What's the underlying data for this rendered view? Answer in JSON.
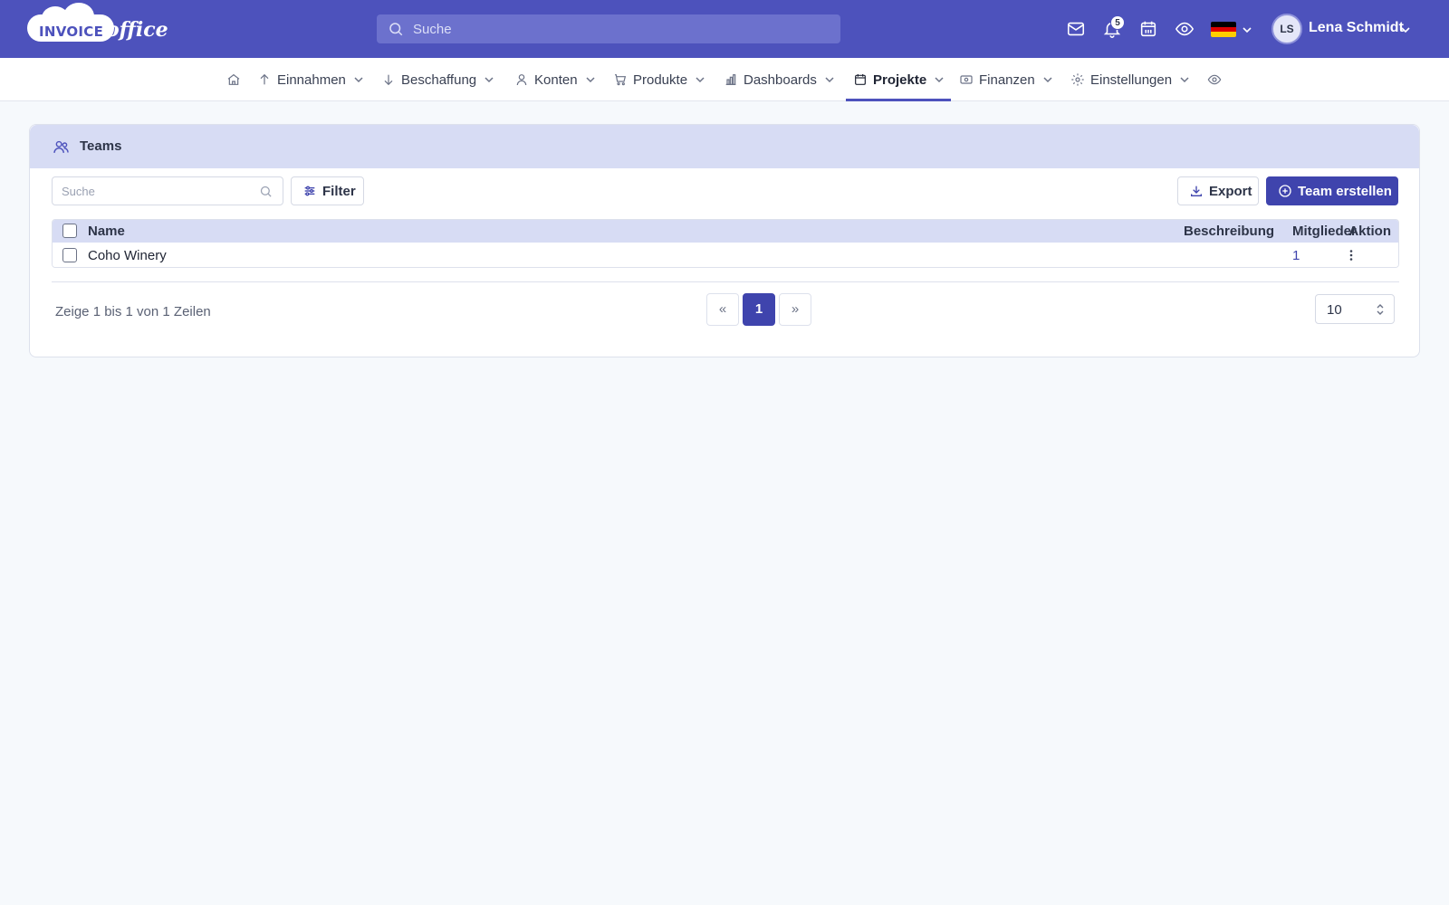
{
  "header": {
    "logo_word1": "INVOICE",
    "logo_word2": "office",
    "search_placeholder": "Suche",
    "notification_count": "5",
    "language_flag": "de-flag",
    "user_initials": "LS",
    "user_name": "Lena Schmidt",
    "icons": [
      "mail-icon",
      "bell-icon",
      "calendar-icon",
      "eye-icon",
      "chevron-down-icon"
    ]
  },
  "nav": {
    "items": [
      {
        "label": "",
        "icon": "home-icon"
      },
      {
        "label": "Einnahmen",
        "icon": "arrow-up-icon"
      },
      {
        "label": "Beschaffung",
        "icon": "arrow-down-icon"
      },
      {
        "label": "Konten",
        "icon": "user-icon"
      },
      {
        "label": "Produkte",
        "icon": "cart-icon"
      },
      {
        "label": "Dashboards",
        "icon": "bar-chart-icon"
      },
      {
        "label": "Projekte",
        "icon": "calendar-icon",
        "active": true
      },
      {
        "label": "Finanzen",
        "icon": "banknote-icon"
      },
      {
        "label": "Einstellungen",
        "icon": "gear-icon"
      },
      {
        "label": "",
        "icon": "eye-icon"
      }
    ]
  },
  "card": {
    "title": "Teams",
    "search_placeholder": "Suche",
    "filter_label": "Filter",
    "export_label": "Export",
    "create_label": "Team erstellen"
  },
  "table": {
    "columns": [
      "Name",
      "Beschreibung",
      "Mitglieder",
      "Aktion"
    ],
    "rows": [
      {
        "name": "Coho Winery",
        "description": "",
        "members": "1"
      }
    ]
  },
  "footer": {
    "summary": "Zeige 1 bis 1 von 1 Zeilen",
    "prev": "«",
    "current_page": "1",
    "next": "»",
    "page_size": "10"
  },
  "colors": {
    "brand": "#4d52bc",
    "primary_button": "#3f44ad",
    "header_tint": "#d7dcf4",
    "background": "#f6f9fc"
  }
}
